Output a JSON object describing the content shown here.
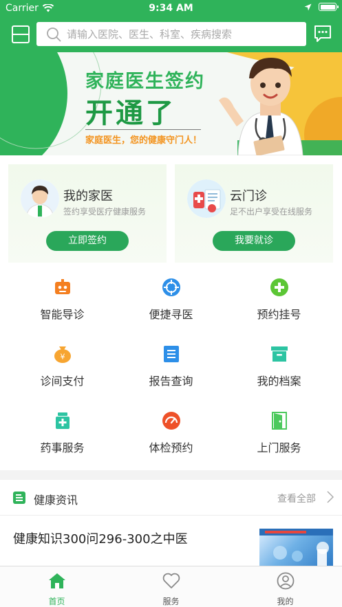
{
  "status_bar": {
    "carrier": "Carrier",
    "time": "9:34 AM"
  },
  "header": {
    "search_placeholder": "请输入医院、医生、科室、疾病搜索"
  },
  "banner": {
    "title_line1": "家庭医生签约",
    "title_line2": "开通了",
    "subtitle": "家庭医生，您的健康守门人！"
  },
  "cards": [
    {
      "title": "我的家医",
      "subtitle": "签约享受医疗健康服务",
      "button": "立即签约"
    },
    {
      "title": "云门诊",
      "subtitle": "足不出户享受在线服务",
      "button": "我要就诊"
    }
  ],
  "services": [
    {
      "label": "智能导诊",
      "icon": "robot-icon",
      "color": "#f47f20"
    },
    {
      "label": "便捷寻医",
      "icon": "target-icon",
      "color": "#2d8fe8"
    },
    {
      "label": "预约挂号",
      "icon": "plus-circle-icon",
      "color": "#5cc635"
    },
    {
      "label": "诊间支付",
      "icon": "money-bag-icon",
      "color": "#f7a531"
    },
    {
      "label": "报告查询",
      "icon": "report-icon",
      "color": "#2d8fe8"
    },
    {
      "label": "我的档案",
      "icon": "archive-icon",
      "color": "#2cc4a2"
    },
    {
      "label": "药事服务",
      "icon": "pharmacy-icon",
      "color": "#2cc4a2"
    },
    {
      "label": "体检预约",
      "icon": "speedometer-icon",
      "color": "#ee5129"
    },
    {
      "label": "上门服务",
      "icon": "door-icon",
      "color": "#4cc95d"
    }
  ],
  "news": {
    "section_title": "健康资讯",
    "view_all": "查看全部",
    "items": [
      {
        "title": "健康知识300问296-300之中医"
      }
    ]
  },
  "tabbar": {
    "items": [
      {
        "label": "首页",
        "active": true
      },
      {
        "label": "服务",
        "active": false
      },
      {
        "label": "我的",
        "active": false
      }
    ]
  },
  "colors": {
    "brand_green": "#2fb35a",
    "button_green": "#2aa75a"
  }
}
